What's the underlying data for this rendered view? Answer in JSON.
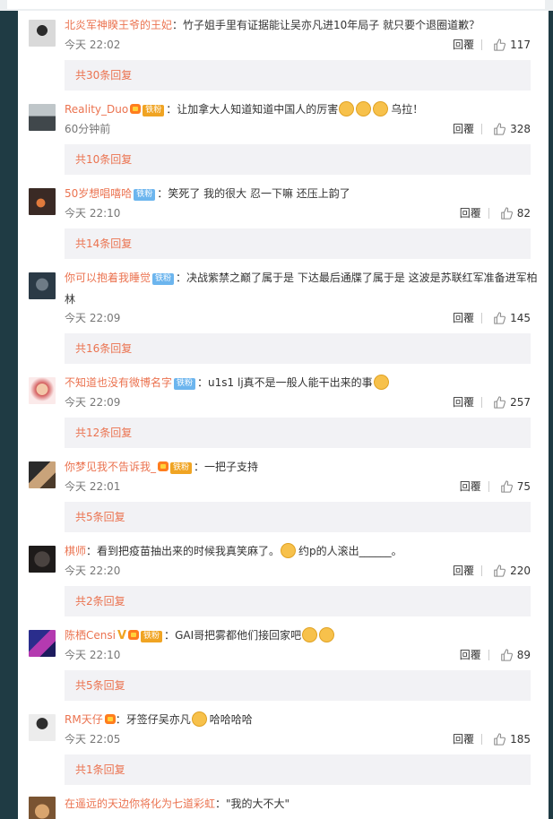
{
  "comments": [
    {
      "user": "北炎军神睽王爷的王妃",
      "badge": "",
      "badge_color": "",
      "vip": false,
      "verified": false,
      "text": "竹子姐手里有证据能让吴亦凡进10年局子 就只要个退圈道歉？",
      "emojis_after": "",
      "text_tail": "",
      "time": "今天 22:02",
      "reply_label": "回覆",
      "likes": "117",
      "more": "共30条回复"
    },
    {
      "user": "Reality_Duo",
      "badge": "铁粉",
      "badge_color": "gold",
      "vip": true,
      "verified": false,
      "text": "让加拿大人知道知道中国人的厉害",
      "emojis_after": "3",
      "text_tail": "乌拉！",
      "time": "60分钟前",
      "reply_label": "回覆",
      "likes": "328",
      "more": "共10条回复"
    },
    {
      "user": "50岁想唱嘻哈",
      "badge": "铁粉",
      "badge_color": "blue",
      "vip": false,
      "verified": false,
      "text": "笑死了 我的很大 忍一下嘛 还压上韵了",
      "emojis_after": "",
      "text_tail": "",
      "time": "今天 22:10",
      "reply_label": "回覆",
      "likes": "82",
      "more": "共14条回复"
    },
    {
      "user": "你可以抱着我睡觉",
      "badge": "铁粉",
      "badge_color": "blue",
      "vip": false,
      "verified": false,
      "text": "决战紫禁之巅了属于是 下达最后通牒了属于是 这波是苏联红军准备进军柏林",
      "emojis_after": "",
      "text_tail": "",
      "time": "今天 22:09",
      "reply_label": "回覆",
      "likes": "145",
      "more": "共16条回复"
    },
    {
      "user": "不知道也没有微博名字",
      "badge": "铁粉",
      "badge_color": "blue",
      "vip": false,
      "verified": false,
      "text": "u1s1 lj真不是一般人能干出来的事",
      "emojis_after": "1",
      "text_tail": "",
      "time": "今天 22:09",
      "reply_label": "回覆",
      "likes": "257",
      "more": "共12条回复"
    },
    {
      "user": "你梦见我不告诉我_",
      "badge": "铁粉",
      "badge_color": "gold",
      "vip": true,
      "verified": false,
      "text": "一把子支持",
      "emojis_after": "",
      "text_tail": "",
      "time": "今天 22:01",
      "reply_label": "回覆",
      "likes": "75",
      "more": "共5条回复"
    },
    {
      "user": "棋师",
      "badge": "",
      "badge_color": "",
      "vip": false,
      "verified": false,
      "text": "看到把疫苗抽出来的时候我真笑麻了。",
      "emojis_after": "1",
      "text_tail": "约p的人滚出______。",
      "time": "今天 22:20",
      "reply_label": "回覆",
      "likes": "220",
      "more": "共2条回复"
    },
    {
      "user": "陈栖Censi",
      "badge": "铁粉",
      "badge_color": "gold",
      "vip": true,
      "verified": true,
      "text": "GAI哥把雾都他们接回家吧",
      "emojis_after": "2",
      "text_tail": "",
      "time": "今天 22:10",
      "reply_label": "回覆",
      "likes": "89",
      "more": "共5条回复"
    },
    {
      "user": "RM天仔",
      "badge": "",
      "badge_color": "",
      "vip": true,
      "verified": false,
      "text": "牙签仔吴亦凡",
      "emojis_after": "1",
      "text_tail": "哈哈哈哈",
      "time": "今天 22:05",
      "reply_label": "回覆",
      "likes": "185",
      "more": "共1条回复"
    },
    {
      "user": "在遥远的天边你将化为七道彩虹",
      "badge": "",
      "badge_color": "",
      "vip": false,
      "verified": false,
      "text": "\"我的大不大\"",
      "emojis_after": "",
      "text_tail": "",
      "time": "",
      "reply_label": "",
      "likes": "",
      "more": ""
    }
  ]
}
